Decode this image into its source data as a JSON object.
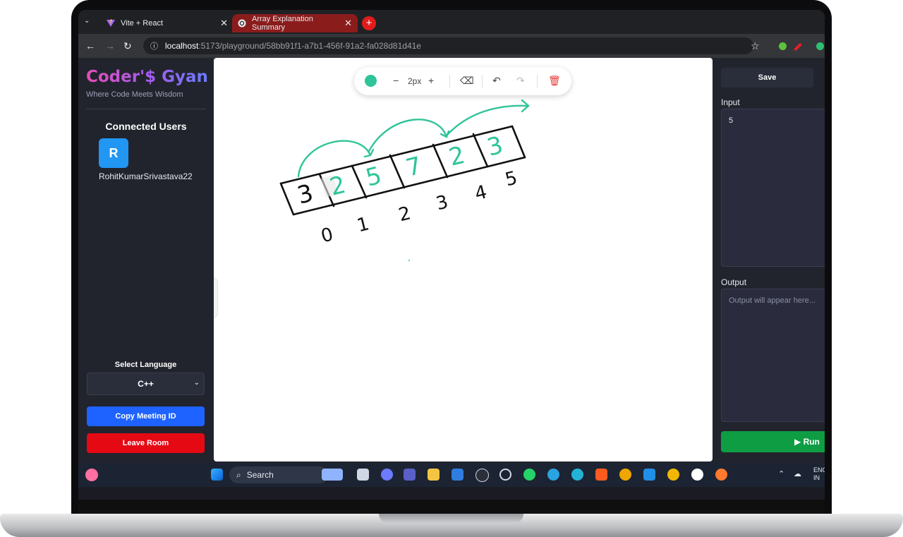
{
  "browser": {
    "tabs": [
      {
        "label": "Vite + React",
        "active": false
      },
      {
        "label": "Array Explanation Summary",
        "active": true
      }
    ],
    "new_tab": "+",
    "url_host": "localhost",
    "url_path": ":5173/playground/58bb91f1-a7b1-456f-91a2-fa028d81d41e"
  },
  "sidebar": {
    "brand": "Coder'$ Gyan",
    "tagline": "Where Code Meets Wisdom",
    "connected_title": "Connected Users",
    "users": [
      {
        "initial": "R",
        "name": "RohitKumarSrivastava22"
      }
    ],
    "language_label": "Select Language",
    "language_value": "C++",
    "copy_button": "Copy Meeting ID",
    "leave_button": "Leave Room"
  },
  "whiteboard": {
    "stroke_width": "2px",
    "colors": {
      "pen": "#2fc49a",
      "ink": "#111111",
      "delete": "#e53935"
    },
    "array_values": [
      "3",
      "2",
      "5",
      "7",
      "2",
      "3"
    ],
    "indices": [
      "0",
      "1",
      "2",
      "3",
      "4",
      "5"
    ]
  },
  "editor": {
    "save_button": "Save",
    "input_label": "Input",
    "input_value": "5",
    "output_label": "Output",
    "output_placeholder": "Output will appear here...",
    "run_button": "▶ Run"
  },
  "taskbar": {
    "search_placeholder": "Search",
    "lang_line1": "ENG",
    "lang_line2": "IN"
  }
}
